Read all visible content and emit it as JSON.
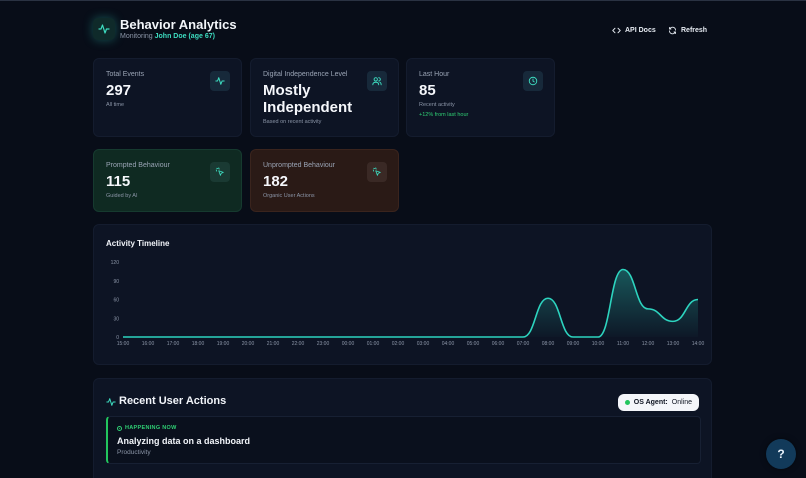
{
  "header": {
    "title": "Behavior Analytics",
    "monitoring_prefix": "Monitoring",
    "user": "John Doe (age 67)",
    "api_docs": "API Docs",
    "refresh": "Refresh"
  },
  "stats": {
    "total_events": {
      "label": "Total Events",
      "value": "297",
      "sub": "All time",
      "icon": "activity-icon"
    },
    "independence": {
      "label": "Digital Independence Level",
      "value_line1": "Mostly",
      "value_line2": "Independent",
      "sub": "Based on recent activity",
      "icon": "users-icon"
    },
    "last_hour": {
      "label": "Last Hour",
      "value": "85",
      "sub": "Recent activity",
      "change": "+12% from last hour",
      "icon": "clock-icon"
    },
    "prompted": {
      "label": "Prompted Behaviour",
      "value": "115",
      "sub": "Guided by AI",
      "icon": "sparkle-cursor-icon"
    },
    "unprompted": {
      "label": "Unprompted Behaviour",
      "value": "182",
      "sub": "Organic User Actions",
      "icon": "sparkle-cursor-icon"
    }
  },
  "timeline": {
    "title": "Activity Timeline"
  },
  "chart_data": {
    "type": "area",
    "title": "Activity Timeline",
    "x": [
      "15:00",
      "16:00",
      "17:00",
      "18:00",
      "19:00",
      "20:00",
      "21:00",
      "22:00",
      "23:00",
      "00:00",
      "01:00",
      "02:00",
      "03:00",
      "04:00",
      "05:00",
      "06:00",
      "07:00",
      "08:00",
      "09:00",
      "10:00",
      "11:00",
      "12:00",
      "13:00",
      "14:00"
    ],
    "values": [
      0,
      0,
      0,
      0,
      0,
      0,
      0,
      0,
      0,
      0,
      0,
      0,
      0,
      0,
      0,
      0,
      0,
      62,
      0,
      0,
      108,
      45,
      25,
      60
    ],
    "yticks": [
      0,
      30,
      60,
      90,
      120
    ],
    "ylim": [
      0,
      120
    ],
    "color": "#2dd4bf"
  },
  "recent": {
    "title": "Recent User Actions",
    "agent_label": "OS Agent:",
    "agent_status": "Online",
    "now_tag": "HAPPENING NOW",
    "now_title": "Analyzing data on a dashboard",
    "now_category": "Productivity"
  },
  "help": "?"
}
